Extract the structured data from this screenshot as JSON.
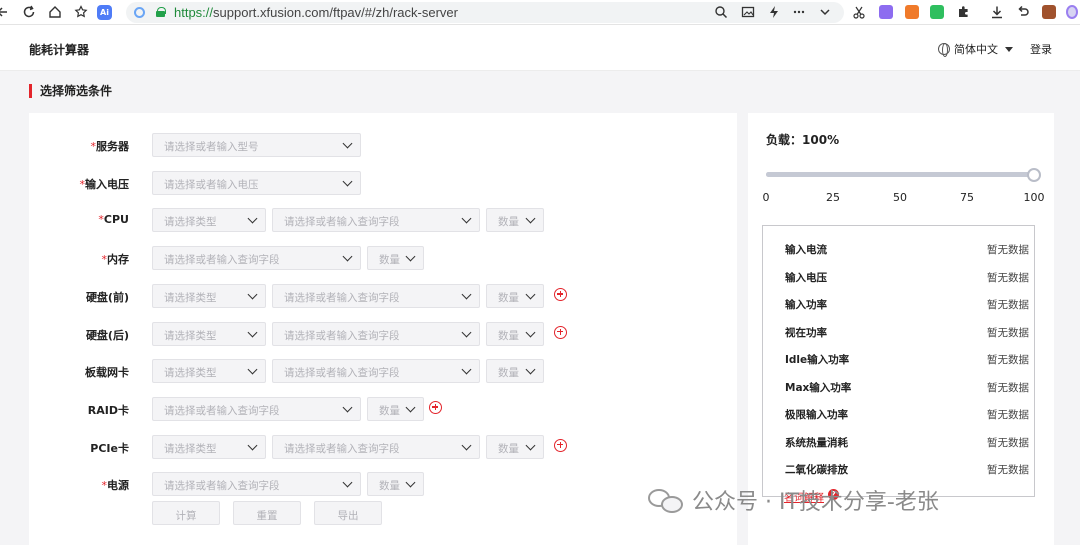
{
  "browser": {
    "url_scheme": "https://",
    "url_rest": "support.xfusion.com/ftpav/#/zh/rack-server",
    "nav_icons": [
      "back-arrow-icon",
      "reload-icon",
      "home-icon",
      "favorite-icon",
      "ai-icon"
    ],
    "tool_icons": [
      "search-icon",
      "image-icon",
      "lightning-icon",
      "more-icon",
      "chevron-down-icon",
      "cut-icon",
      "translate-icon",
      "game-icon",
      "wechat-icon",
      "extensions-icon",
      "download-icon",
      "undo-icon",
      "briefcase-icon",
      "profile-icon"
    ],
    "ai_badge": "Ai"
  },
  "header": {
    "title": "能耗计算器",
    "language": "简体中文",
    "login": "登录"
  },
  "section_title": "选择筛选条件",
  "form": {
    "rows": [
      {
        "label": "服务器",
        "required": "*",
        "selects": [
          {
            "placeholder": "请选择或者输入型号"
          }
        ]
      },
      {
        "label": "输入电压",
        "required": "*",
        "selects": [
          {
            "placeholder": "请选择或者输入电压"
          }
        ]
      },
      {
        "label": "CPU",
        "required": "*",
        "selects": [
          {
            "placeholder": "请选择类型"
          },
          {
            "placeholder": "请选择或者输入查询字段"
          },
          {
            "placeholder": "数量"
          }
        ]
      },
      {
        "label": "内存",
        "required": "*",
        "selects": [
          {
            "placeholder": "请选择或者输入查询字段"
          },
          {
            "placeholder": "数量"
          }
        ]
      },
      {
        "label": "硬盘(前)",
        "required": "",
        "selects": [
          {
            "placeholder": "请选择类型"
          },
          {
            "placeholder": "请选择或者输入查询字段"
          },
          {
            "placeholder": "数量"
          }
        ]
      },
      {
        "label": "硬盘(后)",
        "required": "",
        "selects": [
          {
            "placeholder": "请选择类型"
          },
          {
            "placeholder": "请选择或者输入查询字段"
          },
          {
            "placeholder": "数量"
          }
        ]
      },
      {
        "label": "板载网卡",
        "required": "",
        "selects": [
          {
            "placeholder": "请选择类型"
          },
          {
            "placeholder": "请选择或者输入查询字段"
          },
          {
            "placeholder": "数量"
          }
        ]
      },
      {
        "label": "RAID卡",
        "required": "",
        "selects": [
          {
            "placeholder": "请选择或者输入查询字段"
          },
          {
            "placeholder": "数量"
          }
        ]
      },
      {
        "label": "PCIe卡",
        "required": "",
        "selects": [
          {
            "placeholder": "请选择类型"
          },
          {
            "placeholder": "请选择或者输入查询字段"
          },
          {
            "placeholder": "数量"
          }
        ]
      },
      {
        "label": "电源",
        "required": "*",
        "selects": [
          {
            "placeholder": "请选择或者输入查询字段"
          },
          {
            "placeholder": "数量"
          }
        ]
      }
    ],
    "buttons": {
      "calculate": "计算",
      "reset": "重置",
      "export": "导出"
    }
  },
  "load": {
    "label": "负载：",
    "value_text": "100%",
    "slider_value_percent": 100,
    "ticks": [
      "0",
      "25",
      "50",
      "75",
      "100"
    ]
  },
  "results": [
    {
      "name": "输入电流",
      "value": "暂无数据"
    },
    {
      "name": "输入电压",
      "value": "暂无数据"
    },
    {
      "name": "输入功率",
      "value": "暂无数据"
    },
    {
      "name": "视在功率",
      "value": "暂无数据"
    },
    {
      "name": "Idle输入功率",
      "value": "暂无数据"
    },
    {
      "name": "Max输入功率",
      "value": "暂无数据"
    },
    {
      "name": "极限输入功率",
      "value": "暂无数据"
    },
    {
      "name": "系统热量消耗",
      "value": "暂无数据"
    },
    {
      "name": "二氧化碳排放",
      "value": "暂无数据"
    }
  ],
  "glossary": {
    "label": "名词解释",
    "icon": "?"
  },
  "watermark": {
    "text": "公众号 · IT技术分享-老张"
  },
  "colors": {
    "accent": "#e3242b",
    "secure": "#22a04a",
    "slider": "#c5c9d4"
  }
}
